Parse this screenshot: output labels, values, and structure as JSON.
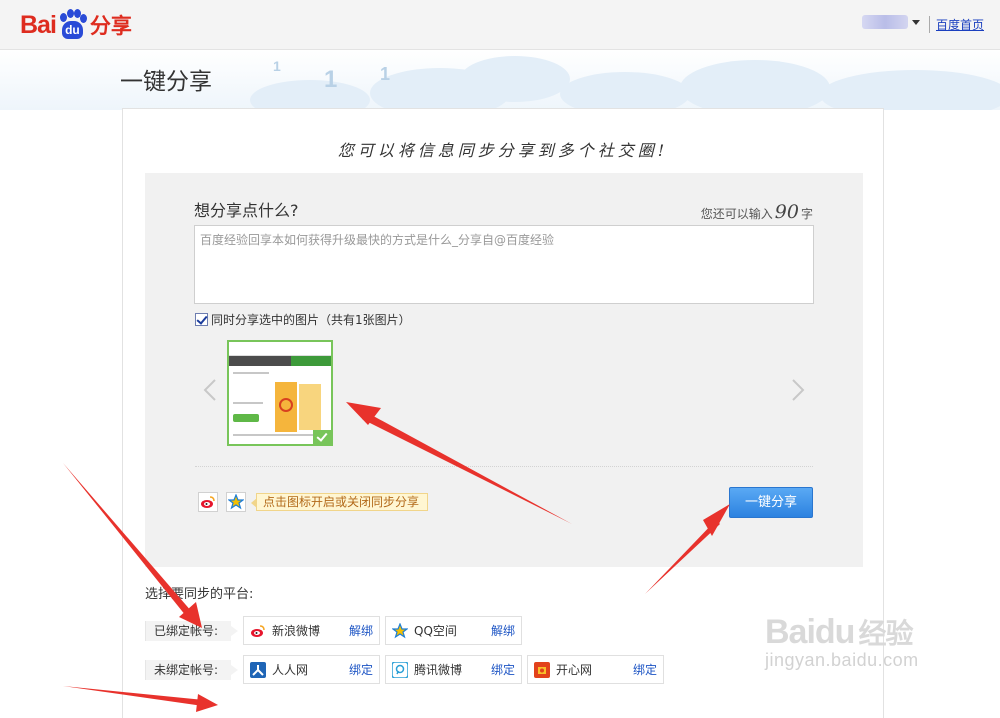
{
  "header": {
    "logo_text_bai": "Bai",
    "logo_text_du": "du",
    "logo_text_share": "分享",
    "home_link": "百度首页"
  },
  "page": {
    "title": "一键分享",
    "slogan": "您可以将信息同步分享到多个社交圈!"
  },
  "composer": {
    "question": "想分享点什么?",
    "remaining_prefix": "您还可以输入",
    "remaining_count": "90",
    "remaining_suffix": "字",
    "text_value": "百度经验回享本如何获得升级最快的方式是什么_分享自@百度经验",
    "share_images_checked": true,
    "share_images_label": "同时分享选中的图片（共有1张图片）",
    "sync_tip": "点击图标开启或关闭同步分享",
    "share_button": "一键分享"
  },
  "platforms": {
    "title": "选择要同步的平台:",
    "bound_label": "已绑定帐号:",
    "unbound_label": "未绑定帐号:",
    "bound": [
      {
        "name": "新浪微博",
        "action": "解绑",
        "icon": "weibo-icon"
      },
      {
        "name": "QQ空间",
        "action": "解绑",
        "icon": "qzone-icon"
      }
    ],
    "unbound": [
      {
        "name": "人人网",
        "action": "绑定",
        "icon": "renren-icon"
      },
      {
        "name": "腾讯微博",
        "action": "绑定",
        "icon": "tencent-weibo-icon"
      },
      {
        "name": "开心网",
        "action": "绑定",
        "icon": "kaixin-icon"
      }
    ]
  },
  "watermark": {
    "logo": "Baidu",
    "logo_suffix": "经验",
    "url": "jingyan.baidu.com"
  },
  "colors": {
    "brand_red": "#de2c1f",
    "brand_blue": "#2a4bd7",
    "button_blue": "#2c82e0",
    "annotation_red": "#e8322c",
    "selected_green": "#78c55a"
  }
}
